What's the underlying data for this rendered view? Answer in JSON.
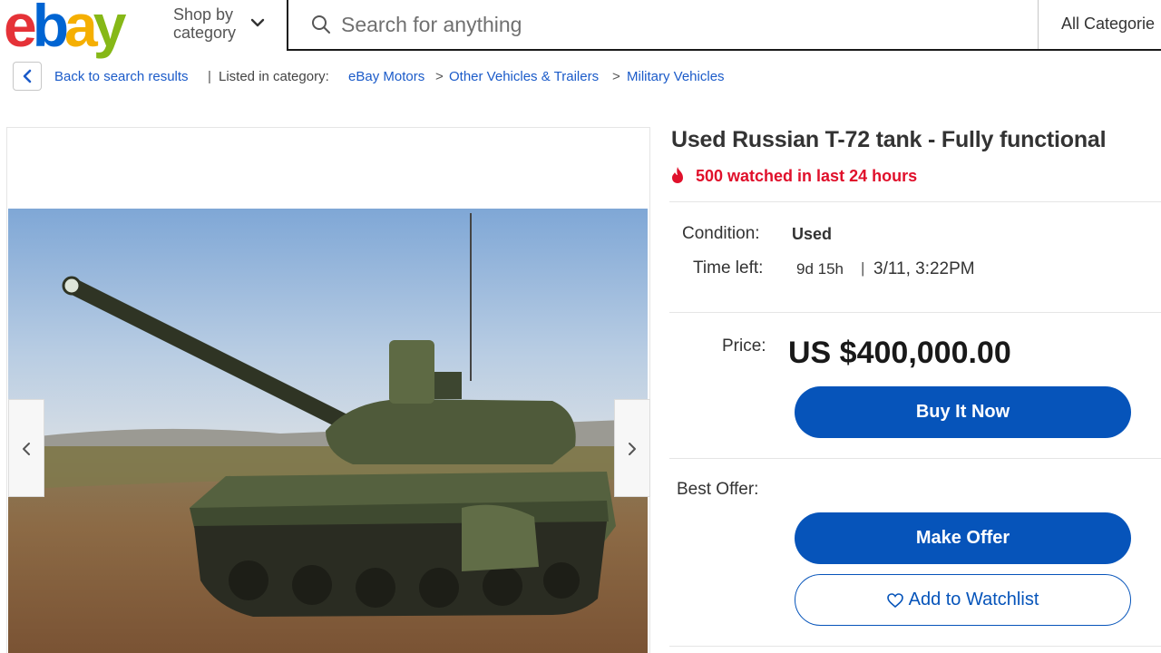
{
  "header": {
    "logo": {
      "letters": [
        "e",
        "b",
        "a",
        "y"
      ],
      "colors": [
        "#e53238",
        "#0064d2",
        "#f5af02",
        "#86b817"
      ]
    },
    "shop_by_line1": "Shop by",
    "shop_by_line2": "category",
    "search_placeholder": "Search for anything",
    "category_select": "All Categorie"
  },
  "breadcrumb": {
    "back_label": "Back to search results",
    "listed_in": "Listed in category:",
    "items": [
      "eBay Motors",
      "Other Vehicles & Trailers",
      "Military Vehicles"
    ],
    "separator": ">",
    "divider": "|"
  },
  "listing": {
    "title": "Used Russian T-72 tank - Fully functional",
    "watched": "500 watched in last 24 hours",
    "condition_label": "Condition:",
    "condition_value": "Used",
    "time_left_label": "Time left:",
    "time_left_value": "9d 15h",
    "time_divider": "|",
    "end_time": "3/11, 3:22PM",
    "price_label": "Price:",
    "price": "US $400,000.00",
    "buy_now": "Buy It Now",
    "best_offer_label": "Best Offer:",
    "make_offer": "Make Offer",
    "watchlist": "Add to Watchlist"
  },
  "colors": {
    "link": "#1b5bc9",
    "primary_button": "#0654ba",
    "urgency": "#e0102b"
  },
  "icons": [
    "chevron-down-icon",
    "search-icon",
    "chevron-left-icon",
    "fire-icon",
    "chevron-right-icon",
    "heart-icon"
  ]
}
